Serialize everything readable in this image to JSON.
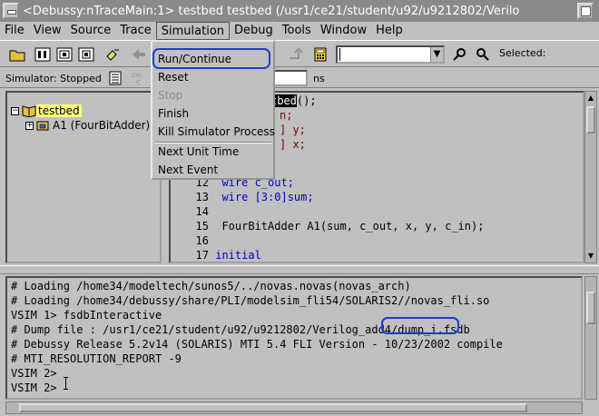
{
  "title_bar": {
    "title": "<Debussy:nTraceMain:1> testbed testbed (/usr1/ce21/student/u92/u9212802/Verilo"
  },
  "menu": {
    "items": [
      {
        "label": "File"
      },
      {
        "label": "View"
      },
      {
        "label": "Source"
      },
      {
        "label": "Trace"
      },
      {
        "label": "Simulation"
      },
      {
        "label": "Debug"
      },
      {
        "label": "Tools"
      },
      {
        "label": "Window"
      },
      {
        "label": "Help"
      }
    ]
  },
  "toolbar": {
    "selected_label": "Selected:"
  },
  "status_row": {
    "simulator_status": "Simulator: Stopped",
    "time_unit": "ns"
  },
  "simulation_menu": {
    "items": [
      {
        "label": "Run/Continue",
        "enabled": true
      },
      {
        "label": "Reset",
        "enabled": true
      },
      {
        "label": "Stop",
        "enabled": false
      },
      {
        "label": "Finish",
        "enabled": true
      },
      {
        "label": "Kill Simulator Process",
        "enabled": true
      },
      {
        "label": "Next Unit Time",
        "enabled": true
      },
      {
        "label": "Next Event",
        "enabled": true
      }
    ]
  },
  "hierarchy_tree": {
    "root": "testbed",
    "children": [
      "A1 (FourBitAdder)"
    ]
  },
  "source_code": {
    "partial_lines": [
      "tbed",
      "();",
      "n;",
      "] y;",
      "] x;"
    ],
    "lines": [
      {
        "number": "12",
        "code": "wire c_out;"
      },
      {
        "number": "13",
        "code": "wire [3:0]sum;"
      },
      {
        "number": "14",
        "code": ""
      },
      {
        "number": "15",
        "code": "FourBitAdder A1(sum, c_out, x, y, c_in);"
      },
      {
        "number": "16",
        "code": ""
      },
      {
        "number": "17",
        "code": "initial"
      }
    ]
  },
  "console": {
    "lines": [
      "# Loading /home34/modeltech/sunos5/../novas.novas(novas_arch)",
      "# Loading /home34/debussy/share/PLI/modelsim_fli54/SOLARIS2//novas_fli.so",
      "VSIM 1> fsdbInteractive",
      "# Dump file : /usr1/ce21/student/u92/u9212802/Verilog_add4/dump_i.fsdb",
      "# Debussy Release 5.2v14 (SOLARIS) MTI 5.4 FLI Version - 10/23/2002 compile",
      "# MTI_RESOLUTION_REPORT -9",
      "VSIM 2>",
      "VSIM 2>"
    ]
  }
}
